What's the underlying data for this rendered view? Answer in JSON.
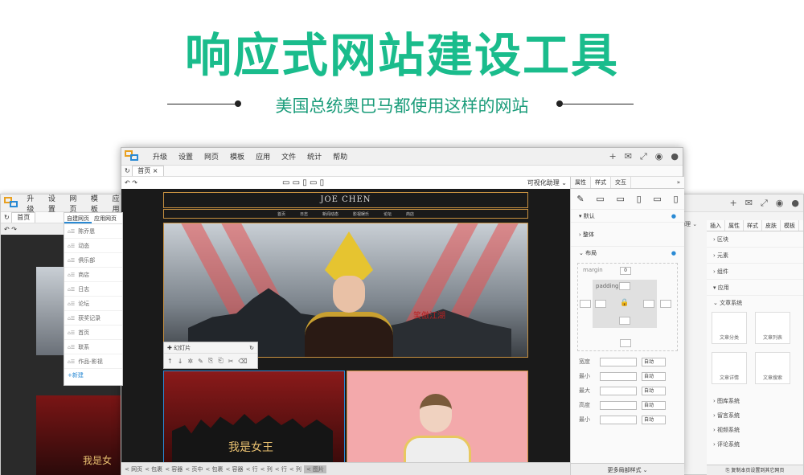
{
  "hero": {
    "title": "响应式网站建设工具",
    "subtitle": "美国总统奥巴马都使用这样的网站"
  },
  "colors": {
    "accent": "#1abc8c",
    "link": "#2a8ad4",
    "frame": "#c79040"
  },
  "main_window": {
    "menu": [
      "升级",
      "设置",
      "网页",
      "模板",
      "应用",
      "文件",
      "统计",
      "帮助"
    ],
    "menu_icons": [
      "plus-icon",
      "mail-icon",
      "fullscreen-icon",
      "eye-icon",
      "user-icon"
    ],
    "tab": "首页",
    "visual_helper": "可视化助理",
    "canvas": {
      "site_title": "JOE CHEN",
      "nav": [
        "首页",
        "日志",
        "新闻动态",
        "影视娱乐",
        "论坛",
        "商店"
      ],
      "banner_caption": "笑傲江湖",
      "slider_label": "幻灯片",
      "photo_caption": "我是女王"
    },
    "breadcrumb": [
      "< 网页",
      "< 包裹",
      "< 容器",
      "< 页中",
      "< 包裹",
      "< 容器",
      "< 行",
      "< 列",
      "< 行",
      "< 列",
      "< 图片"
    ],
    "panel": {
      "tabs": [
        "属性",
        "样式",
        "交互"
      ],
      "sections": {
        "default": "默认",
        "whole": "整体",
        "layout": "布局"
      },
      "margin_label": "margin",
      "margin_value": "0",
      "padding_label": "padding",
      "fields": [
        {
          "label": "宽度",
          "unit": "自动"
        },
        {
          "label": "最小",
          "unit": "自动"
        },
        {
          "label": "最大",
          "unit": "自动"
        },
        {
          "label": "高度",
          "unit": "自动"
        },
        {
          "label": "最小",
          "unit": "自动"
        }
      ],
      "more": "更多局部样式"
    }
  },
  "left_window": {
    "menu": [
      "升级",
      "设置",
      "网页",
      "模板",
      "应用"
    ],
    "tab": "首页",
    "pagelist": {
      "tabs": [
        "自建网页",
        "应用网页"
      ],
      "items": [
        "陈乔恩",
        "动态",
        "俱乐部",
        "商店",
        "日志",
        "论坛",
        "获奖记录",
        "首页",
        "联系",
        "作品-影视"
      ],
      "add": "+新建"
    },
    "photo_caption": "我是女"
  },
  "right_window": {
    "helper": "助理",
    "tabs": [
      "插入",
      "属性",
      "样式",
      "皮肤",
      "模板"
    ],
    "rows": [
      "区块",
      "元素",
      "组件",
      "应用"
    ],
    "app_group": "文章系统",
    "cells": [
      "文章分类",
      "文章列表",
      "文章详情",
      "文章搜索"
    ],
    "systems": [
      "图库系统",
      "留言系统",
      "视频系统",
      "评论系统"
    ],
    "bottom": "复制本页设置到其它网页"
  }
}
